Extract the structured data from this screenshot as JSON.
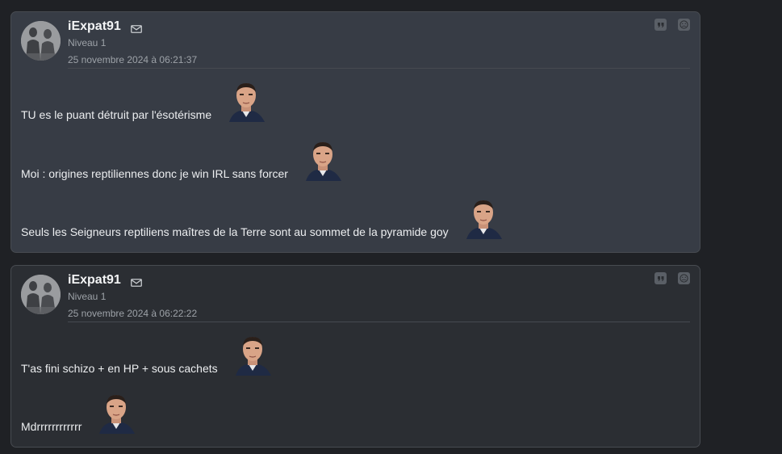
{
  "posts": [
    {
      "author": "iExpat91",
      "level": "Niveau 1",
      "date": "25 novembre 2024 à 06:21:37",
      "lines": [
        "TU es le puant détruit par l'ésotérisme",
        "Moi : origines reptiliennes donc je win IRL sans forcer",
        "Seuls les Seigneurs reptiliens maîtres de la Terre sont au sommet de la pyramide goy"
      ]
    },
    {
      "author": "iExpat91",
      "level": "Niveau 1",
      "date": "25 novembre 2024 à 06:22:22",
      "lines": [
        "T'as fini schizo + en HP + sous cachets",
        "Mdrrrrrrrrrrrr"
      ]
    }
  ],
  "icons": {
    "mail": "mail-icon",
    "quote": "quote-icon",
    "report": "report-icon",
    "sticker": "face-sticker"
  },
  "colors": {
    "page_bg": "#1f2125",
    "post1_bg": "#373c45",
    "post2_bg": "#2b2e33",
    "muted_text": "#9da2a8"
  }
}
